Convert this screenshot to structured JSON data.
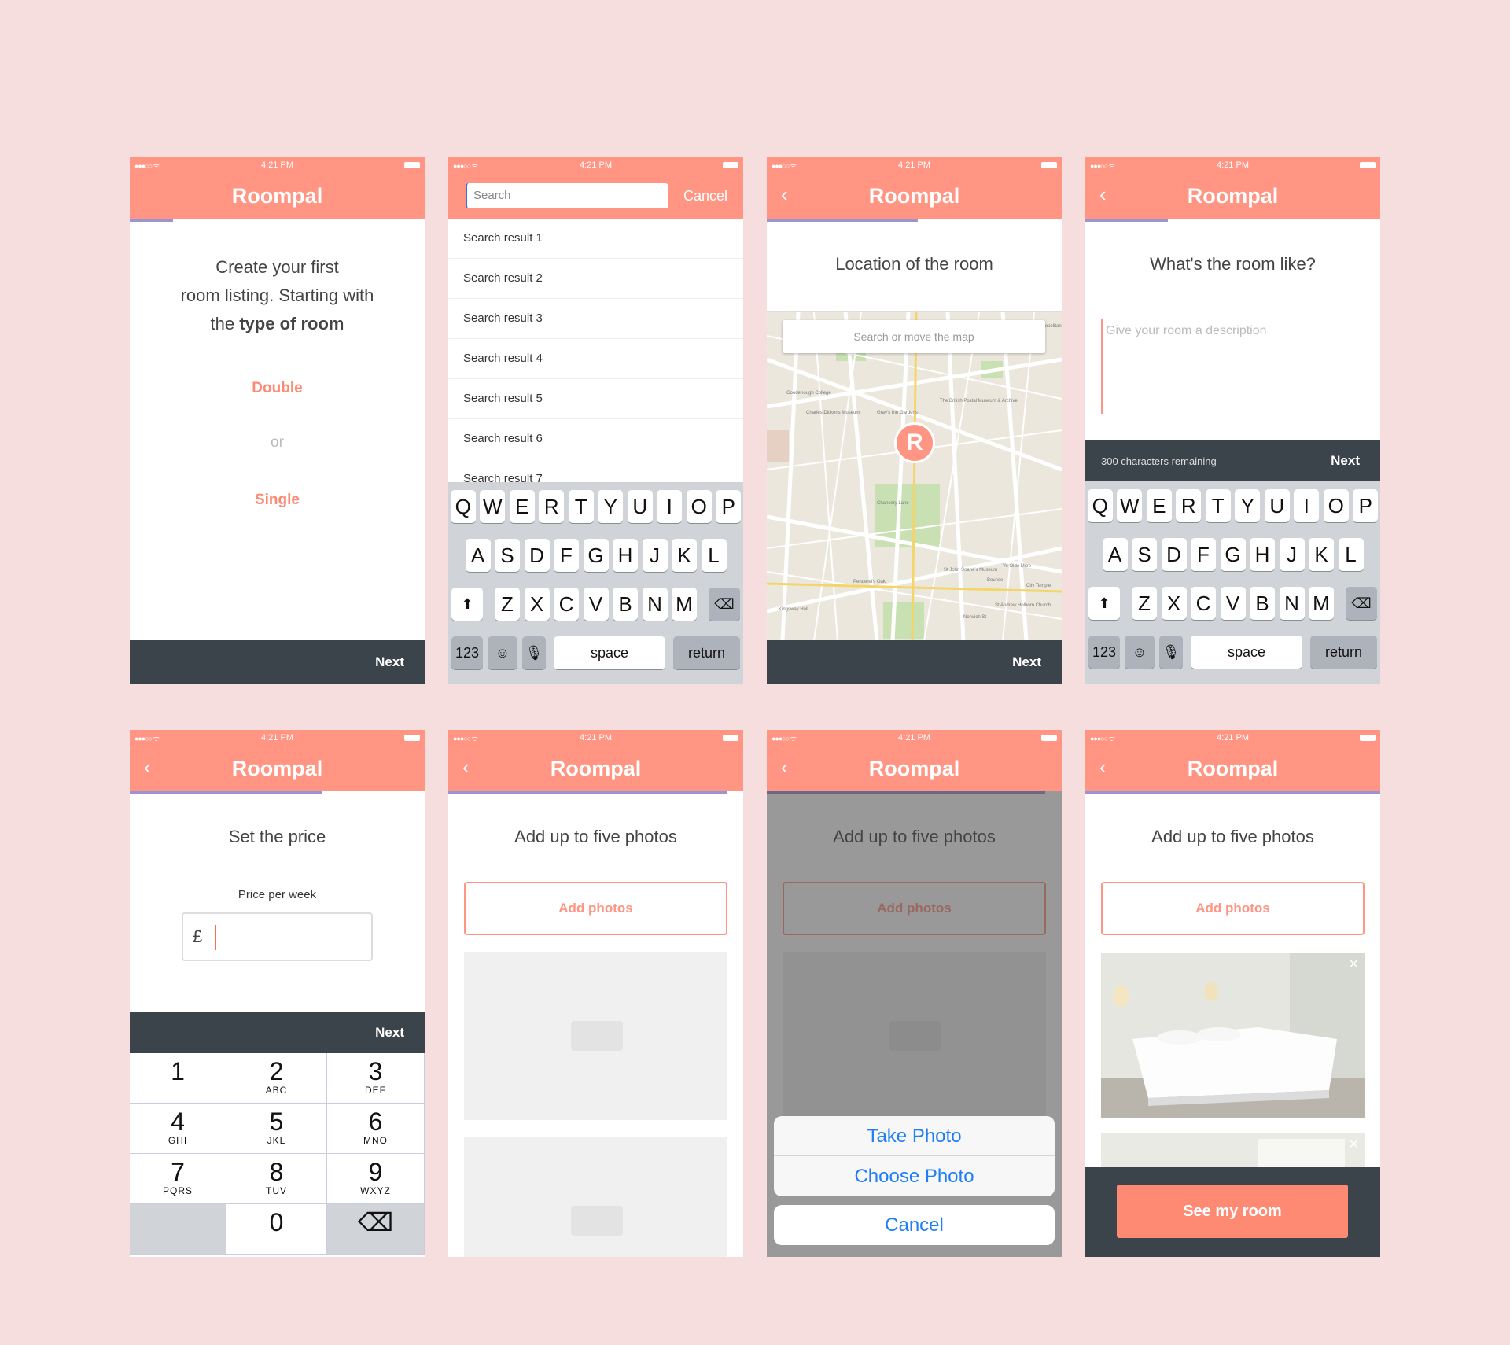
{
  "status": {
    "signal": "●●●○○ ᯤ",
    "time": "4:21 PM"
  },
  "app_title": "Roompal",
  "next_label": "Next",
  "screen1": {
    "line1": "Create your first",
    "line2": "room listing. Starting with",
    "line3_pre": "the ",
    "line3_bold": "type of room",
    "option1": "Double",
    "or": "or",
    "option2": "Single"
  },
  "screen2": {
    "search_placeholder": "Search",
    "cancel": "Cancel",
    "results": [
      "Search result 1",
      "Search result 2",
      "Search result 3",
      "Search result 4",
      "Search result 5",
      "Search result 6",
      "Search result 7"
    ]
  },
  "keyboard": {
    "row1": [
      "Q",
      "W",
      "E",
      "R",
      "T",
      "Y",
      "U",
      "I",
      "O",
      "P"
    ],
    "row2": [
      "A",
      "S",
      "D",
      "F",
      "G",
      "H",
      "J",
      "K",
      "L"
    ],
    "row3": [
      "Z",
      "X",
      "C",
      "V",
      "B",
      "N",
      "M"
    ],
    "k123": "123",
    "space": "space",
    "return": "return"
  },
  "screen3": {
    "heading": "Location of the room",
    "map_search": "Search or move the map",
    "pin": "R",
    "map_labels": [
      "Goodenough College",
      "Charles Dickens Museum",
      "Gray's Inn Gardens",
      "Chancery Lane",
      "St John Soane's Museum",
      "Kingsway Hall",
      "The British Postal Museum & Archive",
      "Penderel's Oak",
      "City Temple",
      "St Andrew Holborn Church",
      "Ye Olde Mitre",
      "Bounce",
      "Norwich St",
      "London Metropolitan Archives"
    ]
  },
  "screen4": {
    "heading": "What's the room like?",
    "placeholder": "Give your room a description",
    "remaining": "300 characters remaining"
  },
  "screen5": {
    "heading": "Set the price",
    "label": "Price per week",
    "currency": "£",
    "keys": [
      {
        "d": "1",
        "l": ""
      },
      {
        "d": "2",
        "l": "ABC"
      },
      {
        "d": "3",
        "l": "DEF"
      },
      {
        "d": "4",
        "l": "GHI"
      },
      {
        "d": "5",
        "l": "JKL"
      },
      {
        "d": "6",
        "l": "MNO"
      },
      {
        "d": "7",
        "l": "PQRS"
      },
      {
        "d": "8",
        "l": "TUV"
      },
      {
        "d": "9",
        "l": "WXYZ"
      },
      {
        "d": "",
        "l": ""
      },
      {
        "d": "0",
        "l": ""
      },
      {
        "d": "⌫",
        "l": ""
      }
    ]
  },
  "photos": {
    "heading": "Add up to five photos",
    "add": "Add photos",
    "sheet": {
      "take": "Take Photo",
      "choose": "Choose Photo",
      "cancel": "Cancel"
    },
    "see": "See my room",
    "close": "×"
  },
  "colors": {
    "bg": "#f5dedd",
    "brand": "#ff9582",
    "accent": "#9b93d3",
    "dark": "#3b434b",
    "ios_blue": "#1f7ef6"
  }
}
